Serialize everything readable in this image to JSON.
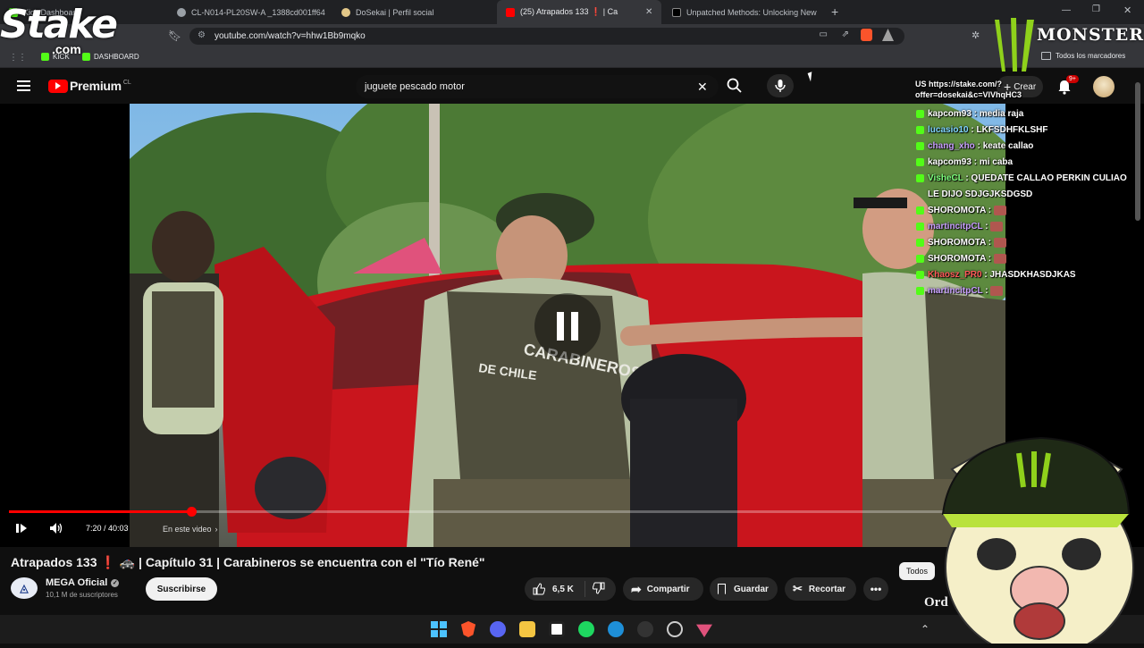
{
  "browser": {
    "tabs": [
      {
        "label": "Kick Dashboard",
        "color": "#53fc18"
      },
      {
        "label": "CL-N014-PL20SW-A _1388cd001ff64",
        "color": "#9aa0a6"
      },
      {
        "label": "DoSekai | Perfil social",
        "color": "#e3c788"
      },
      {
        "label": "(25) Atrapados 133 ❗ | Ca",
        "color": "#ff0000",
        "active": true
      },
      {
        "label": "Unpatched Methods: Unlocking New",
        "color": "#000000"
      }
    ],
    "url": "youtube.com/watch?v=hhw1Bb9mqko",
    "bookmarks": {
      "kick": "KICK",
      "dashboard": "DASHBOARD",
      "all": "Todos los marcadores"
    }
  },
  "overlay": {
    "stake_logo": "Stake",
    "stake_sub": ".com",
    "monster_text": "MONSTER"
  },
  "youtube": {
    "brand": "Premium",
    "country": "CL",
    "search_value": "juguete pescado motor",
    "create_label": "Crear",
    "notif_count": "9+"
  },
  "player": {
    "time": "7:20 / 40:03",
    "chapter": "En este video",
    "progress": 0.183
  },
  "video_info": {
    "title": "Atrapados 133 ❗ 🚓 | Capítulo 31 | Carabineros se encuentra con el \"Tío René\"",
    "channel": "MEGA Oficial",
    "subscribers": "10,1 M de suscriptores",
    "subscribe_label": "Suscribirse",
    "likes": "6,5 K",
    "share_label": "Compartir",
    "save_label": "Guardar",
    "clip_label": "Recortar",
    "filter_all": "Todos",
    "order_partial": "Ord"
  },
  "chat": {
    "header": "US https://stake.com/?offer=dosekai&c=VlVhqHC3",
    "messages": [
      {
        "user": "kapcom93",
        "text": "media raja",
        "color": "#ffffff"
      },
      {
        "user": "lucasio10",
        "text": "LKFSDHFKLSHF",
        "color": "#7fd4ff"
      },
      {
        "user": "chang_xho",
        "text": "keate callao",
        "color": "#c9a0ff"
      },
      {
        "user": "kapcom93",
        "text": "mi caba",
        "color": "#ffffff"
      },
      {
        "user": "VisheCL",
        "text": "QUEDATE CALLAO PERKIN CULIAO LE DIJO SDJGJKSDGSD",
        "color": "#7dff7d"
      },
      {
        "user": "SHOROMOTA",
        "text": "",
        "color": "#ffffff"
      },
      {
        "user": "martincitpCL",
        "text": "",
        "color": "#c9a0ff"
      },
      {
        "user": "SHOROMOTA",
        "text": "",
        "color": "#ffffff"
      },
      {
        "user": "SHOROMOTA",
        "text": "",
        "color": "#ffffff"
      },
      {
        "user": "Khaosz_PR0",
        "text": "JHASDKHASDJKAS",
        "color": "#ff5a5a"
      },
      {
        "user": "martincitpCL",
        "text": "",
        "color": "#c9a0ff"
      }
    ]
  },
  "colors": {
    "kick_green": "#53fc18",
    "yt_red": "#ff0000",
    "bg": "#0f0f0f"
  }
}
